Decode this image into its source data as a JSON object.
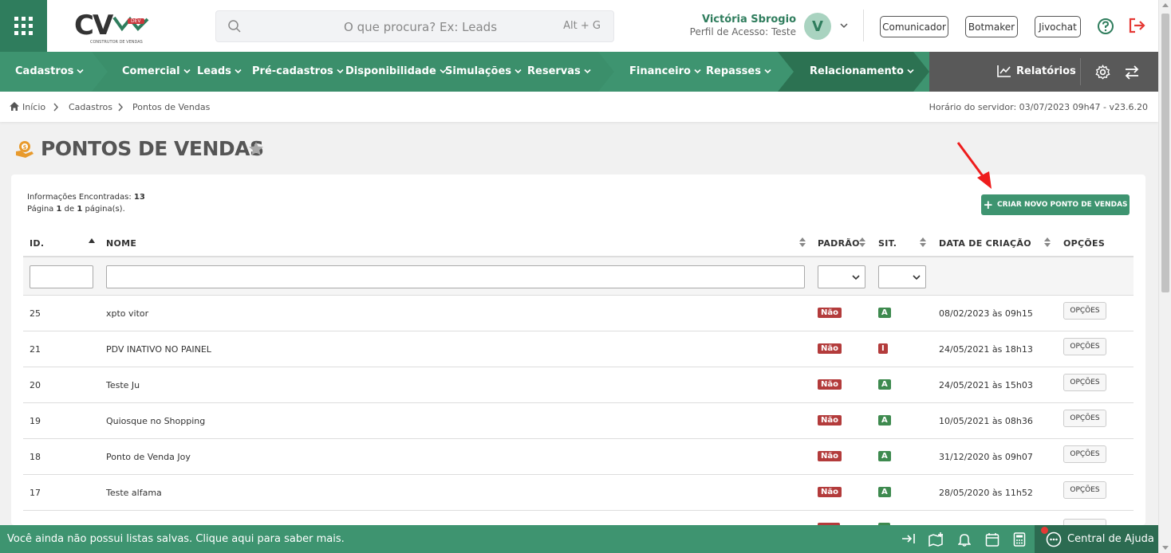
{
  "header": {
    "logo_text": "CV",
    "logo_badge": "DEV",
    "logo_sub": "CONSTRUTOR DE VENDAS",
    "search_placeholder": "O que procura? Ex: Leads",
    "search_shortcut": "Alt + G",
    "user_name": "Victória Sbrogio",
    "user_profile": "Perfil de Acesso: Teste",
    "avatar_letter": "V",
    "buttons": [
      "Comunicador",
      "Botmaker",
      "Jivochat"
    ]
  },
  "nav": {
    "items": [
      "Cadastros",
      "Comercial",
      "Leads",
      "Pré-cadastros",
      "Disponibilidade",
      "Simulações",
      "Reservas",
      "Financeiro",
      "Repasses",
      "Relacionamento"
    ],
    "reports": "Relatórios"
  },
  "breadcrumb": {
    "items": [
      "Início",
      "Cadastros",
      "Pontos de Vendas"
    ],
    "server_time": "Horário do servidor: 03/07/2023 09h47 - v23.6.20"
  },
  "page": {
    "title": "PONTOS DE VENDAS",
    "info_found_label": "Informações Encontradas:",
    "info_found_value": "13",
    "page_word": "Página",
    "page_current": "1",
    "page_of": "de",
    "page_total": "1",
    "page_suffix": "página(s).",
    "create_button": "CRIAR NOVO PONTO DE VENDAS"
  },
  "table": {
    "columns": [
      "ID.",
      "NOME",
      "PADRÃO",
      "SIT.",
      "DATA DE CRIAÇÃO",
      "OPÇÕES"
    ],
    "rows": [
      {
        "id": "25",
        "nome": "xpto vitor",
        "padrao": "Não",
        "sit": "A",
        "data": "08/02/2023 às 09h15",
        "opcoes": "OPÇÕES"
      },
      {
        "id": "21",
        "nome": "PDV INATIVO NO PAINEL",
        "padrao": "Não",
        "sit": "I",
        "data": "24/05/2021 às 18h13",
        "opcoes": "OPÇÕES"
      },
      {
        "id": "20",
        "nome": "Teste Ju",
        "padrao": "Não",
        "sit": "A",
        "data": "24/05/2021 às 15h03",
        "opcoes": "OPÇÕES"
      },
      {
        "id": "19",
        "nome": "Quiosque no Shopping",
        "padrao": "Não",
        "sit": "A",
        "data": "10/05/2021 às 08h36",
        "opcoes": "OPÇÕES"
      },
      {
        "id": "18",
        "nome": "Ponto de Venda Joy",
        "padrao": "Não",
        "sit": "A",
        "data": "31/12/2020 às 09h07",
        "opcoes": "OPÇÕES"
      },
      {
        "id": "17",
        "nome": "Teste alfama",
        "padrao": "Não",
        "sit": "A",
        "data": "28/05/2020 às 11h52",
        "opcoes": "OPÇÕES"
      }
    ]
  },
  "footer": {
    "message": "Você ainda não possui listas salvas. Clique aqui para saber mais.",
    "help_center": "Central de Ajuda"
  },
  "colors": {
    "primary": "#3e9470",
    "dark_green": "#2f7d5d",
    "badge_red": "#b33b3b",
    "badge_green": "#3e8a4f"
  }
}
